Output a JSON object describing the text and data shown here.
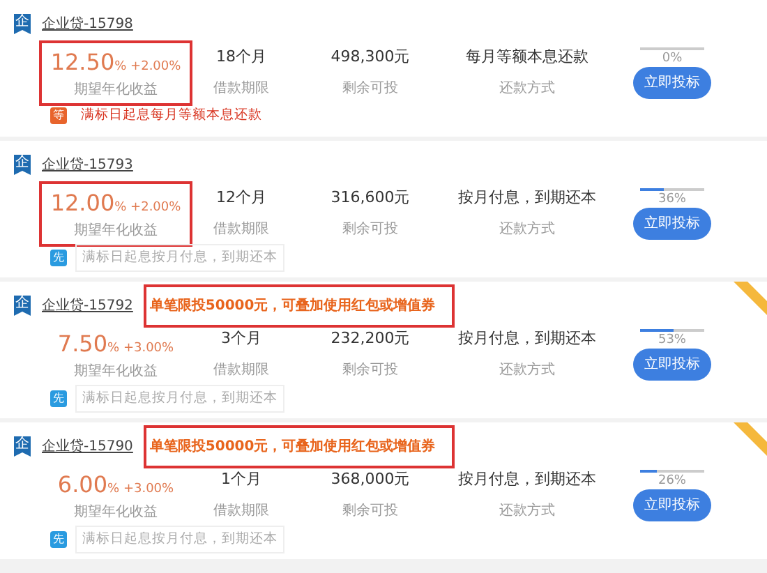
{
  "loans": [
    {
      "type_badge": "企",
      "title": "企业贷-15798",
      "rate": "12.50",
      "rate_unit": "%",
      "bonus": "+2.00%",
      "rate_label": "期望年化收益",
      "rate_highlighted": true,
      "term": "18个月",
      "term_label": "借款期限",
      "remaining": "498,300元",
      "remaining_label": "剩余可投",
      "method": "每月等额本息还款",
      "method_label": "还款方式",
      "level": 0,
      "percent": "0%",
      "button": "立即投标",
      "tag": {
        "kind": "warning",
        "badge": "等",
        "text": "满标日起息每月等额本息还款"
      }
    },
    {
      "type_badge": "企",
      "title": "企业贷-15793",
      "rate": "12.00",
      "rate_unit": "%",
      "bonus": "+2.00%",
      "rate_label": "期望年化收益",
      "rate_highlighted": true,
      "term": "12个月",
      "term_label": "借款期限",
      "remaining": "316,600元",
      "remaining_label": "剩余可投",
      "method": "按月付息，到期还本",
      "method_label": "还款方式",
      "level": 0.36,
      "percent": "36%",
      "button": "立即投标",
      "tag": {
        "kind": "info",
        "badge": "先",
        "text": "满标日起息按月付息，到期还本"
      }
    },
    {
      "type_badge": "企",
      "title": "企业贷-15792",
      "notice": "单笔限投50000元，可叠加使用红包或增值券",
      "ribbon": true,
      "rate": "7.50",
      "rate_unit": "%",
      "bonus": "+3.00%",
      "rate_label": "期望年化收益",
      "rate_highlighted": false,
      "term": "3个月",
      "term_label": "借款期限",
      "remaining": "232,200元",
      "remaining_label": "剩余可投",
      "method": "按月付息，到期还本",
      "method_label": "还款方式",
      "level": 0.53,
      "percent": "53%",
      "button": "立即投标",
      "tag": {
        "kind": "info",
        "badge": "先",
        "text": "满标日起息按月付息，到期还本"
      }
    },
    {
      "type_badge": "企",
      "title": "企业贷-15790",
      "notice": "单笔限投50000元，可叠加使用红包或增值券",
      "ribbon": true,
      "rate": "6.00",
      "rate_unit": "%",
      "bonus": "+3.00%",
      "rate_label": "期望年化收益",
      "rate_highlighted": false,
      "term": "1个月",
      "term_label": "借款期限",
      "remaining": "368,000元",
      "remaining_label": "剩余可投",
      "method": "按月付息，到期还本",
      "method_label": "还款方式",
      "level": 0.26,
      "percent": "26%",
      "button": "立即投标",
      "tag": {
        "kind": "info",
        "badge": "先",
        "text": "满标日起息按月付息，到期还本"
      }
    }
  ]
}
